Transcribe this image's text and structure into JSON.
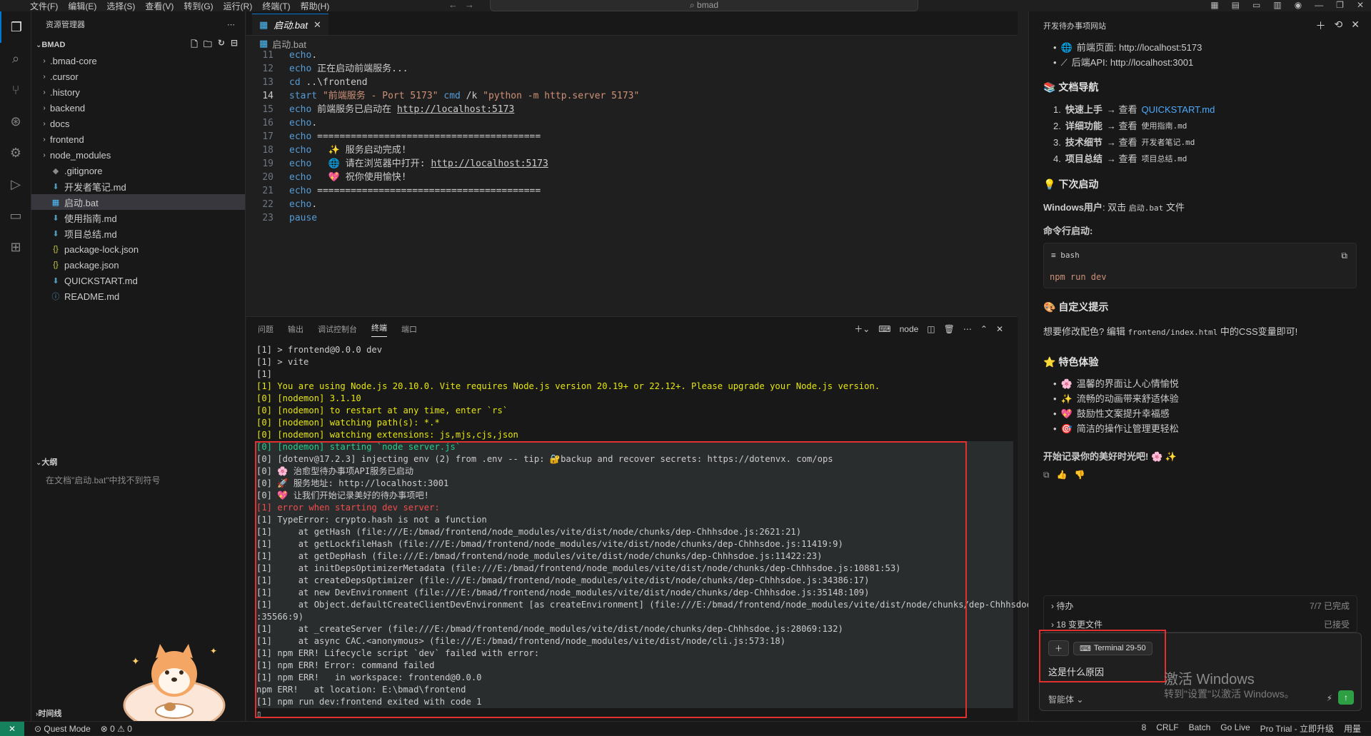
{
  "titlebar": {
    "menus": [
      "文件(F)",
      "编辑(E)",
      "选择(S)",
      "查看(V)",
      "转到(G)",
      "运行(R)",
      "终端(T)",
      "帮助(H)"
    ],
    "search": "bmad"
  },
  "sidebar": {
    "header": "资源管理器",
    "root": "BMAD",
    "items": [
      {
        "name": ".bmad-core",
        "type": "folder"
      },
      {
        "name": ".cursor",
        "type": "folder"
      },
      {
        "name": ".history",
        "type": "folder"
      },
      {
        "name": "backend",
        "type": "folder"
      },
      {
        "name": "docs",
        "type": "folder"
      },
      {
        "name": "frontend",
        "type": "folder"
      },
      {
        "name": "node_modules",
        "type": "folder"
      },
      {
        "name": ".gitignore",
        "type": "file"
      },
      {
        "name": "开发者笔记.md",
        "type": "md"
      },
      {
        "name": "启动.bat",
        "type": "bat"
      },
      {
        "name": "使用指南.md",
        "type": "md"
      },
      {
        "name": "项目总结.md",
        "type": "md"
      },
      {
        "name": "package-lock.json",
        "type": "json"
      },
      {
        "name": "package.json",
        "type": "json"
      },
      {
        "name": "QUICKSTART.md",
        "type": "md"
      },
      {
        "name": "README.md",
        "type": "info"
      }
    ],
    "outline_header": "大纲",
    "outline_empty": "在文档\"启动.bat\"中找不到符号",
    "timeline_header": "时间线"
  },
  "editor": {
    "tab": "启动.bat",
    "breadcrumb": "启动.bat",
    "current_line": "14",
    "lines": [
      {
        "n": "11",
        "parts": [
          {
            "c": "kw",
            "t": "echo"
          },
          {
            "c": "",
            "t": "."
          }
        ]
      },
      {
        "n": "12",
        "parts": [
          {
            "c": "kw",
            "t": "echo"
          },
          {
            "c": "",
            "t": " 正在启动前端服务..."
          }
        ]
      },
      {
        "n": "13",
        "parts": [
          {
            "c": "kw",
            "t": "cd"
          },
          {
            "c": "",
            "t": " ..\\frontend"
          }
        ]
      },
      {
        "n": "14",
        "parts": [
          {
            "c": "kw",
            "t": "start"
          },
          {
            "c": "str",
            "t": " \"前端服务 - Port 5173\""
          },
          {
            "c": "kw",
            "t": " cmd"
          },
          {
            "c": "",
            "t": " /k "
          },
          {
            "c": "str",
            "t": "\"python -m http.server 5173\""
          }
        ]
      },
      {
        "n": "15",
        "parts": [
          {
            "c": "kw",
            "t": "echo"
          },
          {
            "c": "",
            "t": " 前端服务已启动在 "
          },
          {
            "c": "url",
            "t": "http://localhost:5173"
          }
        ]
      },
      {
        "n": "16",
        "parts": [
          {
            "c": "kw",
            "t": "echo"
          },
          {
            "c": "",
            "t": "."
          }
        ]
      },
      {
        "n": "17",
        "parts": [
          {
            "c": "kw",
            "t": "echo"
          },
          {
            "c": "",
            "t": " ========================================"
          }
        ]
      },
      {
        "n": "18",
        "parts": [
          {
            "c": "kw",
            "t": "echo"
          },
          {
            "c": "",
            "t": "   ✨ 服务启动完成!"
          }
        ]
      },
      {
        "n": "19",
        "parts": [
          {
            "c": "kw",
            "t": "echo"
          },
          {
            "c": "",
            "t": "   🌐 请在浏览器中打开: "
          },
          {
            "c": "url",
            "t": "http://localhost:5173"
          }
        ]
      },
      {
        "n": "20",
        "parts": [
          {
            "c": "kw",
            "t": "echo"
          },
          {
            "c": "",
            "t": "   💖 祝你使用愉快!"
          }
        ]
      },
      {
        "n": "21",
        "parts": [
          {
            "c": "kw",
            "t": "echo"
          },
          {
            "c": "",
            "t": " ========================================"
          }
        ]
      },
      {
        "n": "22",
        "parts": [
          {
            "c": "kw",
            "t": "echo"
          },
          {
            "c": "",
            "t": "."
          }
        ]
      },
      {
        "n": "23",
        "parts": [
          {
            "c": "kw",
            "t": "pause"
          }
        ]
      }
    ]
  },
  "panel": {
    "tabs": [
      "问题",
      "输出",
      "调试控制台",
      "终端",
      "端口"
    ],
    "active_tab": "终端",
    "terminal_name": "node",
    "lines": [
      {
        "c": "",
        "t": "[1] > frontend@0.0.0 dev",
        "hl": false
      },
      {
        "c": "",
        "t": "[1] > vite",
        "hl": false
      },
      {
        "c": "",
        "t": "[1]",
        "hl": false
      },
      {
        "c": "y",
        "t": "[1] You are using Node.js 20.10.0. Vite requires Node.js version 20.19+ or 22.12+. Please upgrade your Node.js version.",
        "hl": false
      },
      {
        "c": "y",
        "t": "[0] [nodemon] 3.1.10",
        "hl": false
      },
      {
        "c": "y",
        "t": "[0] [nodemon] to restart at any time, enter `rs`",
        "hl": false
      },
      {
        "c": "y",
        "t": "[0] [nodemon] watching path(s): *.*",
        "hl": false
      },
      {
        "c": "y",
        "t": "[0] [nodemon] watching extensions: js,mjs,cjs,json",
        "hl": false
      },
      {
        "c": "g",
        "t": "[0] [nodemon] starting `node server.js`",
        "hl": true
      },
      {
        "c": "",
        "t": "[0] [dotenv@17.2.3] injecting env (2) from .env -- tip: 🔐backup and recover secrets: https://dotenvx. com/ops",
        "hl": true
      },
      {
        "c": "",
        "t": "[0] 🌸 治愈型待办事项API服务已启动",
        "hl": true
      },
      {
        "c": "",
        "t": "[0] 🚀 服务地址: http://localhost:3001",
        "hl": true
      },
      {
        "c": "",
        "t": "[0] 💖 让我们开始记录美好的待办事项吧!",
        "hl": true
      },
      {
        "c": "r",
        "t": "[1] error when starting dev server:",
        "hl": true
      },
      {
        "c": "",
        "t": "[1] TypeError: crypto.hash is not a function",
        "hl": true
      },
      {
        "c": "",
        "t": "[1]     at getHash (file:///E:/bmad/frontend/node_modules/vite/dist/node/chunks/dep-Chhhsdoe.js:2621:21)",
        "hl": true
      },
      {
        "c": "",
        "t": "[1]     at getLockfileHash (file:///E:/bmad/frontend/node_modules/vite/dist/node/chunks/dep-Chhhsdoe.js:11419:9)",
        "hl": true
      },
      {
        "c": "",
        "t": "[1]     at getDepHash (file:///E:/bmad/frontend/node_modules/vite/dist/node/chunks/dep-Chhhsdoe.js:11422:23)",
        "hl": true
      },
      {
        "c": "",
        "t": "[1]     at initDepsOptimizerMetadata (file:///E:/bmad/frontend/node_modules/vite/dist/node/chunks/dep-Chhhsdoe.js:10881:53)",
        "hl": true
      },
      {
        "c": "",
        "t": "[1]     at createDepsOptimizer (file:///E:/bmad/frontend/node_modules/vite/dist/node/chunks/dep-Chhhsdoe.js:34386:17)",
        "hl": true
      },
      {
        "c": "",
        "t": "[1]     at new DevEnvironment (file:///E:/bmad/frontend/node_modules/vite/dist/node/chunks/dep-Chhhsdoe.js:35148:109)",
        "hl": true
      },
      {
        "c": "",
        "t": "[1]     at Object.defaultCreateClientDevEnvironment [as createEnvironment] (file:///E:/bmad/frontend/node_modules/vite/dist/node/chunks/dep-Chhhsdoe.js",
        "hl": true
      },
      {
        "c": "",
        "t": ":35566:9)",
        "hl": true
      },
      {
        "c": "",
        "t": "[1]     at _createServer (file:///E:/bmad/frontend/node_modules/vite/dist/node/chunks/dep-Chhhsdoe.js:28069:132)",
        "hl": true
      },
      {
        "c": "",
        "t": "[1]     at async CAC.<anonymous> (file:///E:/bmad/frontend/node_modules/vite/dist/node/cli.js:573:18)",
        "hl": true
      },
      {
        "c": "",
        "t": "[1] npm ERR! Lifecycle script `dev` failed with error:",
        "hl": true
      },
      {
        "c": "",
        "t": "[1] npm ERR! Error: command failed",
        "hl": true
      },
      {
        "c": "",
        "t": "[1] npm ERR!   in workspace: frontend@0.0.0",
        "hl": true
      },
      {
        "c": "",
        "t": "npm ERR!   at location: E:\\bmad\\frontend",
        "hl": true
      },
      {
        "c": "",
        "t": "[1] npm run dev:frontend exited with code 1",
        "hl": true
      }
    ]
  },
  "status": {
    "mode": "Quest Mode",
    "problems": "⊗ 0 ⚠ 0",
    "right": [
      "8",
      "CRLF",
      "Batch",
      "Go Live",
      "Pro Trial - 立即升级",
      "用量"
    ]
  },
  "chat": {
    "title": "开发待办事项网站",
    "links": [
      {
        "icon": "🌐",
        "text": "前端页面: http://localhost:5173"
      },
      {
        "icon": "⟋",
        "text": "后端API: http://localhost:3001"
      }
    ],
    "doc_nav_title": "📚 文档导航",
    "doc_nav": [
      {
        "bold": "快速上手",
        "arrow": " → 查看 ",
        "target": "QUICKSTART.md",
        "link": true
      },
      {
        "bold": "详细功能",
        "arrow": " → 查看 ",
        "target": "使用指南.md",
        "link": false
      },
      {
        "bold": "技术细节",
        "arrow": " → 查看 ",
        "target": "开发者笔记.md",
        "link": false
      },
      {
        "bold": "项目总结",
        "arrow": " → 查看 ",
        "target": "项目总结.md",
        "link": false
      }
    ],
    "next_start_title": "💡 下次启动",
    "windows_label": "Windows用户",
    "windows_text": ": 双击 ",
    "windows_code": "启动.bat",
    "windows_tail": " 文件",
    "cli_label": "命令行启动:",
    "code_lang": "bash",
    "code_cmd": "npm run dev",
    "custom_title": "🎨 自定义提示",
    "custom_text_a": "想要修改配色? 编辑 ",
    "custom_code": "frontend/index.html",
    "custom_text_b": " 中的CSS变量即可!",
    "features_title": "⭐ 特色体验",
    "features": [
      {
        "icon": "🌸",
        "text": "温馨的界面让人心情愉悦"
      },
      {
        "icon": "✨",
        "text": "流畅的动画带来舒适体验"
      },
      {
        "icon": "💖",
        "text": "鼓励性文案提升幸福感"
      },
      {
        "icon": "🎯",
        "text": "简洁的操作让管理更轻松"
      }
    ],
    "closing": "开始记录你的美好时光吧! 🌸 ✨",
    "todo_label": "待办",
    "todo_status": "7/7 已完成",
    "changes_label": "18 变更文件",
    "changes_status": "已接受",
    "context_chip": "Terminal 29-50",
    "input_text": "这是什么原因",
    "agent_label": "智能体"
  },
  "watermark": {
    "line1": "激活 Windows",
    "line2": "转到\"设置\"以激活 Windows。"
  }
}
